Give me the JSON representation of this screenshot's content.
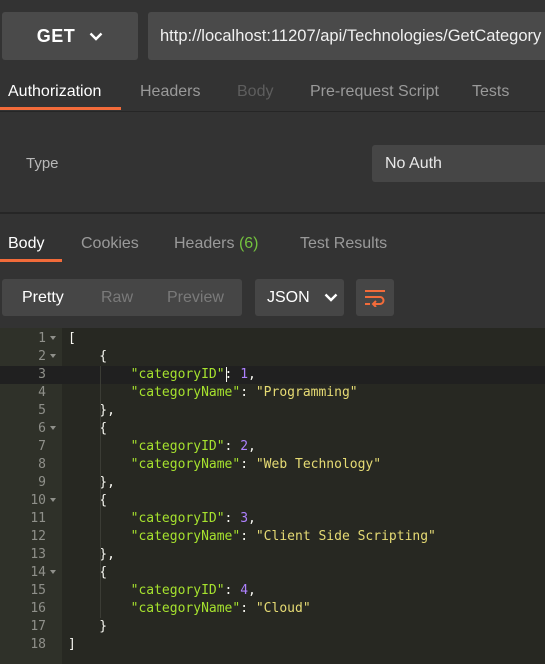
{
  "request": {
    "method": "GET",
    "url": "http://localhost:11207/api/Technologies/GetCategory"
  },
  "request_tabs": [
    "Authorization",
    "Headers",
    "Body",
    "Pre-request Script",
    "Tests"
  ],
  "auth": {
    "type_label": "Type",
    "type_value": "No Auth"
  },
  "response_tabs": {
    "body": "Body",
    "cookies": "Cookies",
    "headers": "Headers",
    "headers_count": "(6)",
    "test_results": "Test Results"
  },
  "view_modes": [
    "Pretty",
    "Raw",
    "Preview"
  ],
  "format": "JSON",
  "icons": {
    "method_dropdown": "chevron-down-icon",
    "format_dropdown": "chevron-down-icon",
    "wrap": "wrap-lines-icon"
  },
  "colors": {
    "accent": "#f26b3a",
    "count": "#73c13e",
    "key": "#a6e22e",
    "number": "#ae81ff",
    "string": "#e6db74"
  },
  "editor": {
    "lines": [
      {
        "n": "1",
        "fold": true,
        "parts": [
          [
            "p",
            "["
          ]
        ]
      },
      {
        "n": "2",
        "fold": true,
        "parts": [
          [
            "p",
            "    {"
          ]
        ]
      },
      {
        "n": "3",
        "fold": false,
        "current": true,
        "parts": [
          [
            "p",
            "        "
          ],
          [
            "k",
            "\"categoryID\""
          ],
          [
            "p",
            ": "
          ],
          [
            "n",
            "1"
          ],
          [
            "p",
            ","
          ]
        ]
      },
      {
        "n": "4",
        "fold": false,
        "parts": [
          [
            "p",
            "        "
          ],
          [
            "k",
            "\"categoryName\""
          ],
          [
            "p",
            ": "
          ],
          [
            "s",
            "\"Programming\""
          ]
        ]
      },
      {
        "n": "5",
        "fold": false,
        "parts": [
          [
            "p",
            "    },"
          ]
        ]
      },
      {
        "n": "6",
        "fold": true,
        "parts": [
          [
            "p",
            "    {"
          ]
        ]
      },
      {
        "n": "7",
        "fold": false,
        "parts": [
          [
            "p",
            "        "
          ],
          [
            "k",
            "\"categoryID\""
          ],
          [
            "p",
            ": "
          ],
          [
            "n",
            "2"
          ],
          [
            "p",
            ","
          ]
        ]
      },
      {
        "n": "8",
        "fold": false,
        "parts": [
          [
            "p",
            "        "
          ],
          [
            "k",
            "\"categoryName\""
          ],
          [
            "p",
            ": "
          ],
          [
            "s",
            "\"Web Technology\""
          ]
        ]
      },
      {
        "n": "9",
        "fold": false,
        "parts": [
          [
            "p",
            "    },"
          ]
        ]
      },
      {
        "n": "10",
        "fold": true,
        "parts": [
          [
            "p",
            "    {"
          ]
        ]
      },
      {
        "n": "11",
        "fold": false,
        "parts": [
          [
            "p",
            "        "
          ],
          [
            "k",
            "\"categoryID\""
          ],
          [
            "p",
            ": "
          ],
          [
            "n",
            "3"
          ],
          [
            "p",
            ","
          ]
        ]
      },
      {
        "n": "12",
        "fold": false,
        "parts": [
          [
            "p",
            "        "
          ],
          [
            "k",
            "\"categoryName\""
          ],
          [
            "p",
            ": "
          ],
          [
            "s",
            "\"Client Side Scripting\""
          ]
        ]
      },
      {
        "n": "13",
        "fold": false,
        "parts": [
          [
            "p",
            "    },"
          ]
        ]
      },
      {
        "n": "14",
        "fold": true,
        "parts": [
          [
            "p",
            "    {"
          ]
        ]
      },
      {
        "n": "15",
        "fold": false,
        "parts": [
          [
            "p",
            "        "
          ],
          [
            "k",
            "\"categoryID\""
          ],
          [
            "p",
            ": "
          ],
          [
            "n",
            "4"
          ],
          [
            "p",
            ","
          ]
        ]
      },
      {
        "n": "16",
        "fold": false,
        "parts": [
          [
            "p",
            "        "
          ],
          [
            "k",
            "\"categoryName\""
          ],
          [
            "p",
            ": "
          ],
          [
            "s",
            "\"Cloud\""
          ]
        ]
      },
      {
        "n": "17",
        "fold": false,
        "parts": [
          [
            "p",
            "    }"
          ]
        ]
      },
      {
        "n": "18",
        "fold": false,
        "parts": [
          [
            "p",
            "]"
          ]
        ]
      }
    ]
  }
}
